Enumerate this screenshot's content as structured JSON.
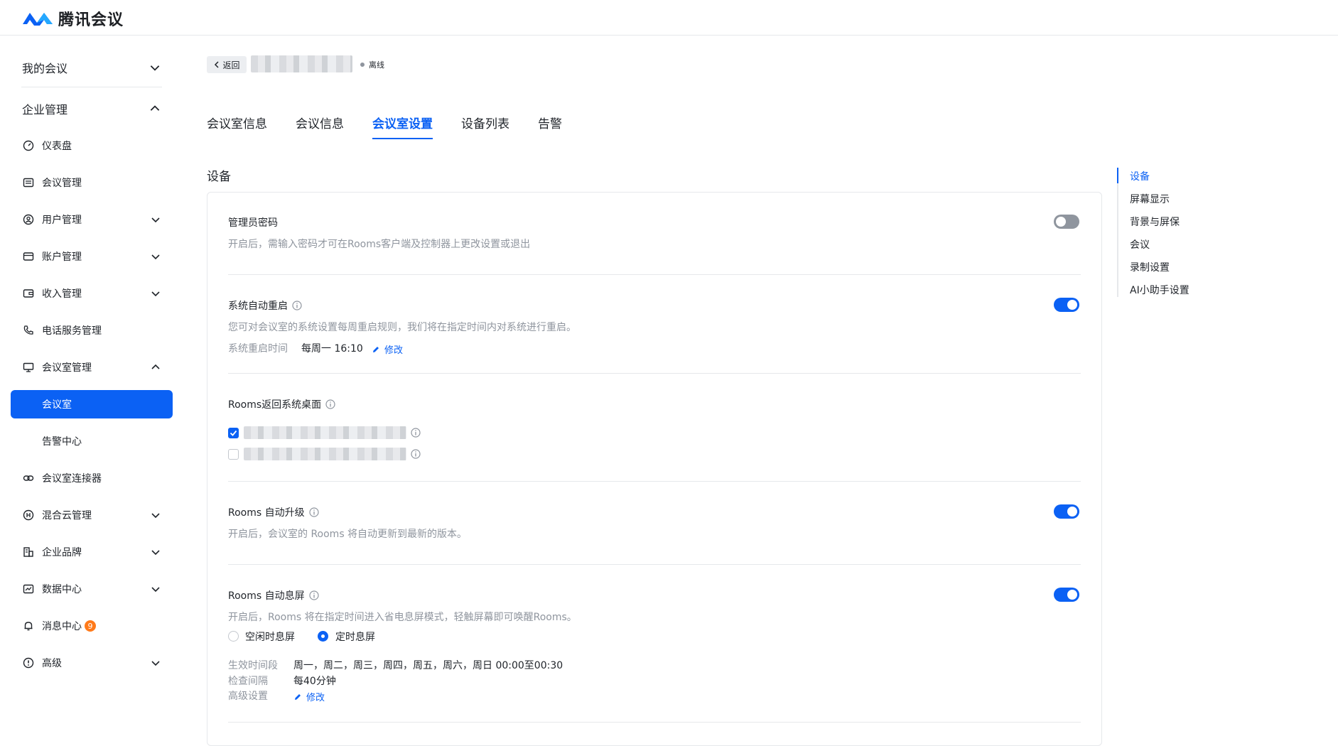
{
  "app": {
    "name": "腾讯会议",
    "brand_color": "#0b61f4"
  },
  "sidebar": {
    "top_items": [
      {
        "label": "我的会议",
        "expanded": false
      },
      {
        "label": "企业管理",
        "expanded": true
      }
    ],
    "items": [
      {
        "label": "仪表盘",
        "icon": "dashboard-icon"
      },
      {
        "label": "会议管理",
        "icon": "meeting-list-icon"
      },
      {
        "label": "用户管理",
        "icon": "user-icon"
      },
      {
        "label": "账户管理",
        "icon": "card-icon"
      },
      {
        "label": "收入管理",
        "icon": "wallet-icon"
      },
      {
        "label": "电话服务管理",
        "icon": "phone-icon"
      },
      {
        "label": "会议室管理",
        "icon": "monitor-icon"
      },
      {
        "label": "会议室",
        "icon": ""
      },
      {
        "label": "告警中心",
        "icon": ""
      },
      {
        "label": "会议室连接器",
        "icon": "link-icon"
      },
      {
        "label": "混合云管理",
        "icon": "cloud-icon"
      },
      {
        "label": "企业品牌",
        "icon": "building-icon"
      },
      {
        "label": "数据中心",
        "icon": "chart-icon"
      },
      {
        "label": "消息中心",
        "icon": "bell-icon",
        "badge": "9"
      },
      {
        "label": "高级",
        "icon": "advanced-icon"
      }
    ]
  },
  "header": {
    "back_label": "返回",
    "status": "离线"
  },
  "tabs": [
    "会议室信息",
    "会议信息",
    "会议室设置",
    "设备列表",
    "告警"
  ],
  "active_tab": "会议室设置",
  "section": {
    "title": "设备"
  },
  "settings": {
    "admin_password": {
      "title": "管理员密码",
      "desc": "开启后，需输入密码才可在Rooms客户端及控制器上更改设置或退出",
      "enabled": false
    },
    "auto_restart": {
      "title": "系统自动重启",
      "desc": "您可对会议室的系统设置每周重启规则，我们将在指定时间内对系统进行重启。",
      "time_label": "系统重启时间",
      "time_value": "每周一 16:10",
      "edit_label": "修改",
      "enabled": true
    },
    "return_desktop": {
      "title": "Rooms返回系统桌面",
      "options": [
        {
          "checked": true
        },
        {
          "checked": false
        }
      ]
    },
    "auto_upgrade": {
      "title": "Rooms 自动升级",
      "desc": "开启后，会议室的 Rooms 将自动更新到最新的版本。",
      "enabled": true
    },
    "auto_sleep": {
      "title": "Rooms 自动息屏",
      "desc": "开启后，Rooms 将在指定时间进入省电息屏模式，轻触屏幕即可唤醒Rooms。",
      "enabled": true,
      "radio_idle": "空闲时息屏",
      "radio_timed": "定时息屏",
      "selected": "定时息屏",
      "effective_label": "生效时间段",
      "effective_value": "周一，周二，周三，周四，周五，周六，周日 00:00至00:30",
      "interval_label": "检查间隔",
      "interval_value": "每40分钟",
      "advanced_label": "高级设置",
      "edit_label": "修改"
    }
  },
  "anchor_nav": [
    "设备",
    "屏幕显示",
    "背景与屏保",
    "会议",
    "录制设置",
    "AI小助手设置"
  ],
  "anchor_active": "设备"
}
